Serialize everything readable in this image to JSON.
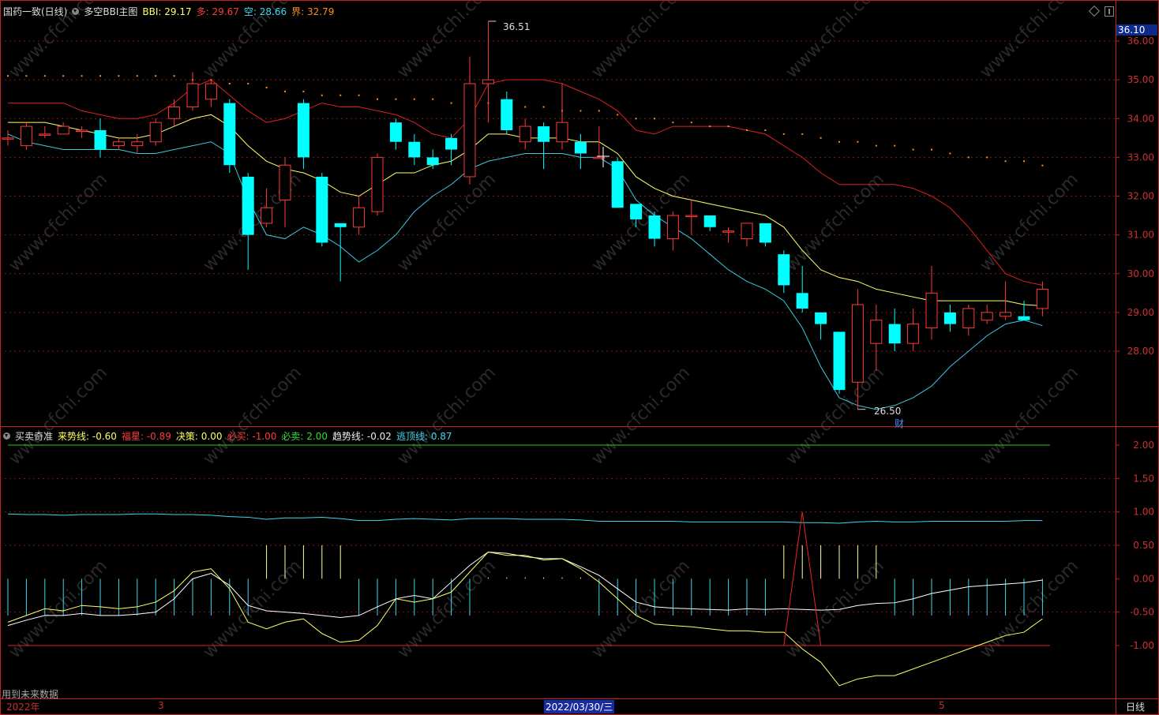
{
  "main_header": {
    "stock": "国药一致(日线)",
    "indicator": "多空BBI主图",
    "bbi_label": "BBI:",
    "bbi_value": "29.17",
    "duo_label": "多:",
    "duo_value": "29.67",
    "kong_label": "空:",
    "kong_value": "28.66",
    "jie_label": "界:",
    "jie_value": "32.79"
  },
  "sub_header": {
    "indicator": "买卖奇准",
    "l1_label": "来势线:",
    "l1_value": "-0.60",
    "l2_label": "福星:",
    "l2_value": "-0.89",
    "l3_label": "决策:",
    "l3_value": "0.00",
    "l4_label": "必买:",
    "l4_value": "-1.00",
    "l5_label": "必卖:",
    "l5_value": "2.00",
    "l6_label": "趋势线:",
    "l6_value": "-0.02",
    "l7_label": "逃顶线:",
    "l7_value": "0.87"
  },
  "current_price": "36.10",
  "annotations": {
    "high": "36.51",
    "low": "26.50",
    "cai": "财"
  },
  "footer": {
    "note": "用到未来数据",
    "year": "2022年",
    "m3": "3",
    "date": "2022/03/30/三",
    "m5": "5",
    "period": "日线"
  },
  "colors": {
    "up": "#ff3a3a",
    "down": "#00ffff",
    "bbi": "#ffff66",
    "upper": "#e02020",
    "lower": "#3cc8e0",
    "grid": "#7a1a1a",
    "axis": "#c82020"
  },
  "chart_data": [
    {
      "type": "candlestick",
      "ylim": [
        26.3,
        36.6
      ],
      "yticks": [
        "36.00",
        "35.00",
        "34.00",
        "33.00",
        "32.00",
        "31.00",
        "30.00",
        "29.00",
        "28.00"
      ],
      "candles": [
        [
          33.5,
          33.5,
          33.3,
          33.7
        ],
        [
          33.3,
          33.8,
          33.2,
          33.9
        ],
        [
          33.6,
          33.6,
          33.5,
          33.8
        ],
        [
          33.6,
          33.8,
          33.6,
          33.9
        ],
        [
          33.7,
          33.7,
          33.5,
          33.8
        ],
        [
          33.7,
          33.2,
          33.0,
          34.0
        ],
        [
          33.3,
          33.4,
          33.2,
          33.5
        ],
        [
          33.3,
          33.4,
          33.1,
          33.6
        ],
        [
          33.4,
          33.9,
          33.3,
          34.0
        ],
        [
          34.0,
          34.3,
          33.8,
          34.5
        ],
        [
          34.3,
          34.9,
          34.2,
          35.2
        ],
        [
          34.5,
          34.9,
          34.3,
          35.0
        ],
        [
          34.4,
          32.8,
          32.6,
          34.5
        ],
        [
          32.5,
          31.0,
          30.1,
          32.6
        ],
        [
          31.3,
          31.7,
          31.2,
          32.2
        ],
        [
          31.9,
          32.8,
          31.2,
          33.0
        ],
        [
          34.4,
          33.0,
          32.7,
          34.5
        ],
        [
          32.5,
          30.8,
          30.7,
          32.6
        ],
        [
          31.3,
          31.2,
          29.8,
          31.3
        ],
        [
          31.2,
          31.7,
          31.0,
          32.0
        ],
        [
          31.6,
          33.0,
          31.5,
          33.1
        ],
        [
          33.9,
          33.4,
          33.2,
          34.0
        ],
        [
          33.4,
          33.0,
          32.8,
          33.6
        ],
        [
          33.0,
          32.8,
          32.7,
          33.2
        ],
        [
          33.5,
          33.2,
          32.8,
          33.6
        ],
        [
          32.5,
          34.9,
          32.3,
          35.6
        ],
        [
          34.9,
          35.0,
          33.9,
          36.5
        ],
        [
          34.5,
          33.7,
          33.6,
          34.7
        ],
        [
          33.4,
          33.8,
          33.2,
          34.0
        ],
        [
          33.8,
          33.4,
          32.7,
          33.9
        ],
        [
          33.4,
          33.9,
          33.2,
          34.9
        ],
        [
          33.4,
          33.1,
          32.7,
          33.6
        ],
        [
          33.0,
          33.0,
          33.0,
          33.8
        ],
        [
          32.9,
          31.7,
          31.7,
          33.0
        ],
        [
          31.8,
          31.4,
          31.2,
          31.8
        ],
        [
          31.5,
          30.9,
          30.7,
          31.6
        ],
        [
          30.9,
          31.5,
          30.6,
          31.6
        ],
        [
          31.5,
          31.5,
          31.0,
          31.9
        ],
        [
          31.5,
          31.2,
          31.1,
          31.5
        ],
        [
          31.1,
          31.1,
          30.8,
          31.2
        ],
        [
          30.9,
          31.3,
          30.7,
          31.3
        ],
        [
          31.3,
          30.8,
          30.7,
          31.3
        ],
        [
          30.5,
          29.7,
          29.5,
          30.6
        ],
        [
          29.5,
          29.1,
          29.0,
          30.2
        ],
        [
          29.0,
          28.7,
          28.3,
          29.0
        ],
        [
          28.5,
          27.0,
          26.9,
          28.5
        ],
        [
          27.2,
          29.2,
          26.5,
          29.6
        ],
        [
          28.2,
          28.8,
          27.5,
          29.2
        ],
        [
          28.7,
          28.2,
          28.0,
          29.1
        ],
        [
          28.2,
          28.7,
          28.0,
          29.1
        ],
        [
          28.6,
          29.5,
          28.3,
          30.2
        ],
        [
          29.0,
          28.7,
          28.5,
          29.2
        ],
        [
          28.6,
          29.1,
          28.4,
          29.2
        ],
        [
          28.8,
          29.0,
          28.7,
          29.2
        ],
        [
          28.9,
          29.0,
          28.8,
          29.8
        ],
        [
          28.9,
          28.8,
          28.8,
          29.3
        ],
        [
          29.1,
          29.6,
          28.9,
          29.8
        ]
      ],
      "upper": [
        34.4,
        34.4,
        34.4,
        34.4,
        34.2,
        34.1,
        34.0,
        34.0,
        34.1,
        34.4,
        34.8,
        35.0,
        34.6,
        34.2,
        33.9,
        34.0,
        34.2,
        34.4,
        34.3,
        34.3,
        34.2,
        34.1,
        33.9,
        33.6,
        33.5,
        34.0,
        34.9,
        35.0,
        35.0,
        35.0,
        34.9,
        34.7,
        34.5,
        34.2,
        33.7,
        33.6,
        33.8,
        33.8,
        33.8,
        33.8,
        33.7,
        33.6,
        33.3,
        33.0,
        32.6,
        32.3,
        32.3,
        32.3,
        32.3,
        32.2,
        32.0,
        31.7,
        31.2,
        30.6,
        30.0,
        29.8,
        29.7
      ],
      "bbi": [
        33.9,
        33.9,
        33.9,
        33.8,
        33.7,
        33.6,
        33.5,
        33.5,
        33.6,
        33.8,
        34.0,
        34.1,
        33.8,
        33.3,
        32.9,
        32.7,
        32.6,
        32.4,
        32.1,
        32.0,
        32.3,
        32.6,
        32.6,
        32.8,
        32.9,
        33.2,
        33.6,
        33.6,
        33.5,
        33.5,
        33.5,
        33.4,
        33.4,
        33.1,
        32.5,
        32.2,
        32.0,
        31.9,
        31.8,
        31.7,
        31.6,
        31.5,
        31.2,
        30.6,
        30.1,
        29.9,
        29.8,
        29.6,
        29.5,
        29.4,
        29.3,
        29.3,
        29.3,
        29.3,
        29.3,
        29.2,
        29.17
      ],
      "lower": [
        33.6,
        33.4,
        33.3,
        33.2,
        33.2,
        33.2,
        33.2,
        33.1,
        33.1,
        33.2,
        33.3,
        33.4,
        33.1,
        31.9,
        31.0,
        30.9,
        31.2,
        31.0,
        30.7,
        30.3,
        30.6,
        31.0,
        31.6,
        32.0,
        32.3,
        32.7,
        32.9,
        33.0,
        33.1,
        33.1,
        33.1,
        33.0,
        33.0,
        32.7,
        31.9,
        31.5,
        31.2,
        30.9,
        30.5,
        30.1,
        29.8,
        29.6,
        29.3,
        28.6,
        27.6,
        26.8,
        26.6,
        26.5,
        26.6,
        26.8,
        27.1,
        27.6,
        28.0,
        28.4,
        28.7,
        28.8,
        28.66
      ],
      "jie": [
        35.1,
        35.1,
        35.1,
        35.1,
        35.1,
        35.1,
        35.1,
        35.1,
        35.1,
        35.1,
        35.0,
        35.0,
        34.9,
        34.9,
        34.8,
        34.7,
        34.7,
        34.6,
        34.6,
        34.6,
        34.5,
        34.5,
        34.5,
        34.5,
        34.4,
        34.4,
        34.4,
        34.3,
        34.3,
        34.3,
        34.2,
        34.2,
        34.2,
        34.1,
        34.0,
        34.0,
        33.9,
        33.9,
        33.8,
        33.8,
        33.7,
        33.7,
        33.6,
        33.6,
        33.5,
        33.4,
        33.4,
        33.3,
        33.3,
        33.2,
        33.2,
        33.1,
        33.0,
        33.0,
        32.9,
        32.9,
        32.79
      ]
    },
    {
      "type": "line",
      "ylim": [
        -1.85,
        2.2
      ],
      "yticks": [
        "2.00",
        "1.50",
        "1.00",
        "0.50",
        "0.00",
        "-0.50",
        "-1.00"
      ],
      "must_sell": 2.0,
      "must_buy": -1.0,
      "escape": [
        0.97,
        0.96,
        0.96,
        0.95,
        0.96,
        0.96,
        0.96,
        0.97,
        0.97,
        0.96,
        0.96,
        0.95,
        0.93,
        0.92,
        0.89,
        0.91,
        0.91,
        0.92,
        0.9,
        0.87,
        0.87,
        0.89,
        0.9,
        0.89,
        0.88,
        0.9,
        0.9,
        0.9,
        0.89,
        0.89,
        0.89,
        0.88,
        0.86,
        0.86,
        0.86,
        0.86,
        0.86,
        0.85,
        0.85,
        0.85,
        0.85,
        0.85,
        0.85,
        0.84,
        0.84,
        0.83,
        0.85,
        0.86,
        0.85,
        0.85,
        0.86,
        0.86,
        0.86,
        0.86,
        0.86,
        0.87,
        0.87
      ],
      "laishi": [
        -0.65,
        -0.55,
        -0.45,
        -0.48,
        -0.4,
        -0.42,
        -0.45,
        -0.42,
        -0.35,
        -0.18,
        0.1,
        0.15,
        -0.15,
        -0.65,
        -0.75,
        -0.65,
        -0.6,
        -0.82,
        -0.95,
        -0.92,
        -0.7,
        -0.3,
        -0.35,
        -0.3,
        -0.2,
        0.1,
        0.4,
        0.35,
        0.35,
        0.28,
        0.3,
        0.15,
        -0.05,
        -0.3,
        -0.55,
        -0.68,
        -0.7,
        -0.72,
        -0.75,
        -0.78,
        -0.78,
        -0.8,
        -0.8,
        -1.05,
        -1.25,
        -1.6,
        -1.5,
        -1.45,
        -1.45,
        -1.35,
        -1.25,
        -1.15,
        -1.05,
        -0.95,
        -0.85,
        -0.8,
        -0.6
      ],
      "fuxing": [
        -0.7,
        -0.62,
        -0.55,
        -0.55,
        -0.52,
        -0.55,
        -0.55,
        -0.53,
        -0.5,
        -0.3,
        0.0,
        0.08,
        -0.1,
        -0.4,
        -0.48,
        -0.5,
        -0.52,
        -0.55,
        -0.58,
        -0.55,
        -0.42,
        -0.3,
        -0.25,
        -0.3,
        -0.05,
        0.2,
        0.4,
        0.38,
        0.33,
        0.3,
        0.3,
        0.18,
        0.05,
        -0.15,
        -0.35,
        -0.42,
        -0.44,
        -0.45,
        -0.46,
        -0.47,
        -0.45,
        -0.46,
        -0.45,
        -0.46,
        -0.47,
        -0.46,
        -0.4,
        -0.37,
        -0.36,
        -0.3,
        -0.22,
        -0.17,
        -0.12,
        -0.1,
        -0.08,
        -0.06,
        -0.02
      ],
      "juece": [
        0,
        0,
        0,
        0,
        0,
        0,
        0,
        0,
        0,
        0,
        0,
        0,
        0,
        0,
        0,
        0,
        0,
        0,
        0,
        0,
        0,
        0,
        0,
        0,
        0,
        0,
        0,
        0,
        0,
        0,
        0,
        0,
        0,
        0,
        0,
        0,
        0,
        0,
        0,
        0,
        0,
        0,
        0,
        1.0,
        0,
        0,
        0,
        0,
        0,
        0,
        0,
        0,
        0,
        0,
        0,
        0,
        0
      ]
    }
  ]
}
